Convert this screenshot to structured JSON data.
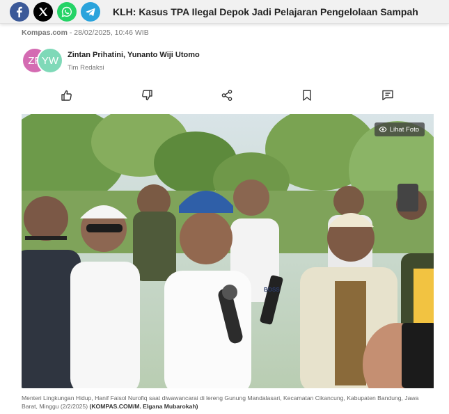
{
  "share_bar": {
    "title": "KLH: Kasus TPA Ilegal Depok Jadi Pelajaran Pengelolaan Sampah",
    "buttons": [
      {
        "icon": "facebook-icon",
        "color": "#3b5998"
      },
      {
        "icon": "x-icon",
        "color": "#000000"
      },
      {
        "icon": "whatsapp-icon",
        "color": "#25d366"
      },
      {
        "icon": "telegram-icon",
        "color": "#2aa3dc"
      }
    ]
  },
  "meta": {
    "source": "Kompas.com",
    "separator": " - ",
    "datetime": "28/02/2025, 10:46 WIB"
  },
  "authors": {
    "avatars": [
      "ZP",
      "YW"
    ],
    "names": "Zintan Prihatini,  Yunanto Wiji Utomo",
    "team": "Tim Redaksi"
  },
  "actions": [
    "like-icon",
    "dislike-icon",
    "share-icon",
    "bookmark-icon",
    "comment-icon"
  ],
  "photo": {
    "view_label": "Lihat Foto",
    "view_icon": "eye-icon",
    "cap_text": "BOSS"
  },
  "caption": {
    "text": "Menteri Lingkungan Hidup, Hanif Faisol Nurofiq saat diwawancarai di lereng Gunung Mandalasari, Kecamatan Cikancung, Kabupaten Bandung, Jawa Barat, Minggu (2/2/2025)",
    "credit": "(KOMPAS.COM/M. Elgana Mubarokah)"
  }
}
